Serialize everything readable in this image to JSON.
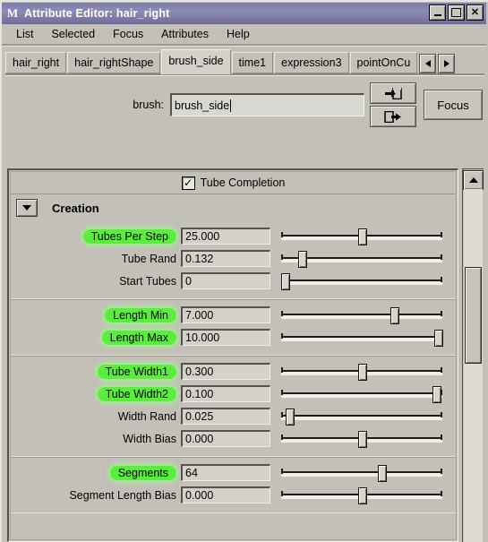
{
  "window": {
    "app_icon": "maya-logo-icon",
    "title": "Attribute Editor: hair_right",
    "buttons": {
      "minimize": "minimize-icon",
      "maximize": "maximize-icon",
      "close": "close-icon"
    }
  },
  "menubar": {
    "items": [
      {
        "label": "List"
      },
      {
        "label": "Selected"
      },
      {
        "label": "Focus"
      },
      {
        "label": "Attributes"
      },
      {
        "label": "Help"
      }
    ]
  },
  "tabs": {
    "items": [
      {
        "label": "hair_right",
        "active": false
      },
      {
        "label": "hair_rightShape",
        "active": false
      },
      {
        "label": "brush_side",
        "active": true
      },
      {
        "label": "time1",
        "active": false
      },
      {
        "label": "expression3",
        "active": false
      },
      {
        "label": "pointOnCu",
        "active": false
      }
    ],
    "scroll_left": "triangle-left-icon",
    "scroll_right": "triangle-right-icon"
  },
  "node_row": {
    "label": "brush:",
    "value": "brush_side",
    "placeholder": "",
    "load_button_icon": "arrow-into-box-icon",
    "send_button_icon": "arrow-out-of-box-icon",
    "focus_label": "Focus"
  },
  "panel": {
    "completion": {
      "label": "Tube Completion",
      "checked": true,
      "check_glyph": "✓"
    },
    "section": {
      "title": "Creation",
      "collapse_icon": "triangle-down-icon"
    },
    "groups": [
      {
        "rows": [
          {
            "label": "Tubes Per Step",
            "highlight": true,
            "value": "25.000",
            "slider_pct": 50
          },
          {
            "label": "Tube Rand",
            "highlight": false,
            "value": "0.132",
            "slider_pct": 13
          },
          {
            "label": "Start Tubes",
            "highlight": false,
            "value": "0",
            "slider_pct": 2
          }
        ]
      },
      {
        "rows": [
          {
            "label": "Length Min",
            "highlight": true,
            "value": "7.000",
            "slider_pct": 70
          },
          {
            "label": "Length Max",
            "highlight": true,
            "value": "10.000",
            "slider_pct": 97
          }
        ]
      },
      {
        "rows": [
          {
            "label": "Tube Width1",
            "highlight": true,
            "value": "0.300",
            "slider_pct": 50
          },
          {
            "label": "Tube Width2",
            "highlight": true,
            "value": "0.100",
            "slider_pct": 96
          },
          {
            "label": "Width Rand",
            "highlight": false,
            "value": "0.025",
            "slider_pct": 5
          },
          {
            "label": "Width Bias",
            "highlight": false,
            "value": "0.000",
            "slider_pct": 50
          }
        ]
      },
      {
        "rows": [
          {
            "label": "Segments",
            "highlight": true,
            "value": "64",
            "slider_pct": 62
          },
          {
            "label": "Segment Length Bias",
            "highlight": false,
            "value": "0.000",
            "slider_pct": 50
          }
        ]
      }
    ],
    "scrollbar": {
      "up_icon": "triangle-up-icon",
      "thumb_top_pct": 22,
      "thumb_height_pct": 27
    }
  },
  "colors": {
    "window_bg": "#c3c0b8",
    "titlebar": "#7c7ba8",
    "highlight_green": "#5aee3c",
    "field_bg": "#d3d1ca"
  }
}
